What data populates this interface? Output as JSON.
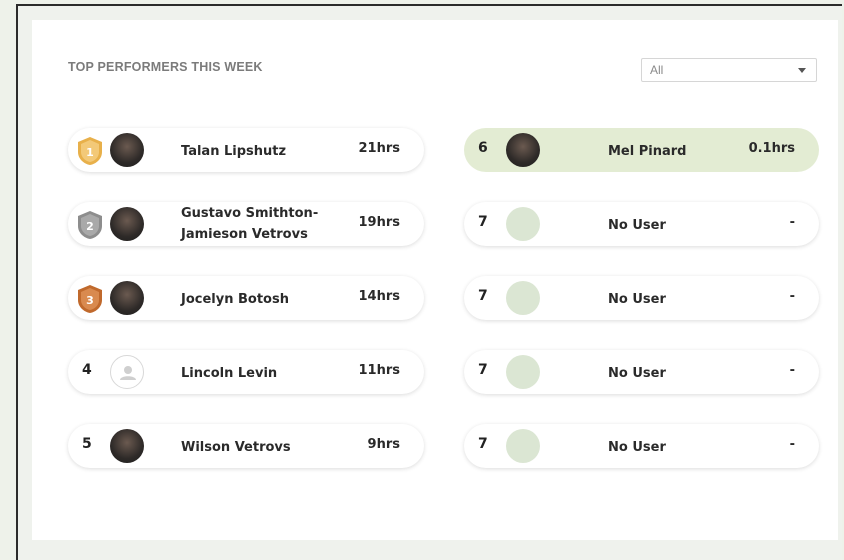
{
  "title": "TOP PERFORMERS THIS WEEK",
  "filter": {
    "selected": "All"
  },
  "colors": {
    "gold": "#e8b04a",
    "silver": "#8d8d8d",
    "bronze": "#c0692c",
    "active_row": "#e3ecd3",
    "empty_avatar": "#dbe6d3"
  },
  "left": [
    {
      "rank": "1",
      "badge": "gold-medal",
      "name": "Talan Lipshutz",
      "hours": "21hrs"
    },
    {
      "rank": "2",
      "badge": "silver-medal",
      "name_line1": "Gustavo Smithton-",
      "name_line2": "Jamieson Vetrovs",
      "hours": "19hrs"
    },
    {
      "rank": "3",
      "badge": "bronze-medal",
      "name": "Jocelyn Botosh",
      "hours": "14hrs"
    },
    {
      "rank": "4",
      "name": "Lincoln Levin",
      "hours": "11hrs"
    },
    {
      "rank": "5",
      "name": "Wilson Vetrovs",
      "hours": "9hrs"
    }
  ],
  "right": [
    {
      "rank": "6",
      "name": "Mel Pinard",
      "hours": "0.1hrs"
    },
    {
      "rank": "7",
      "name": "No User",
      "hours": "-"
    },
    {
      "rank": "7",
      "name": "No User",
      "hours": "-"
    },
    {
      "rank": "7",
      "name": "No User",
      "hours": "-"
    },
    {
      "rank": "7",
      "name": "No User",
      "hours": "-"
    }
  ]
}
